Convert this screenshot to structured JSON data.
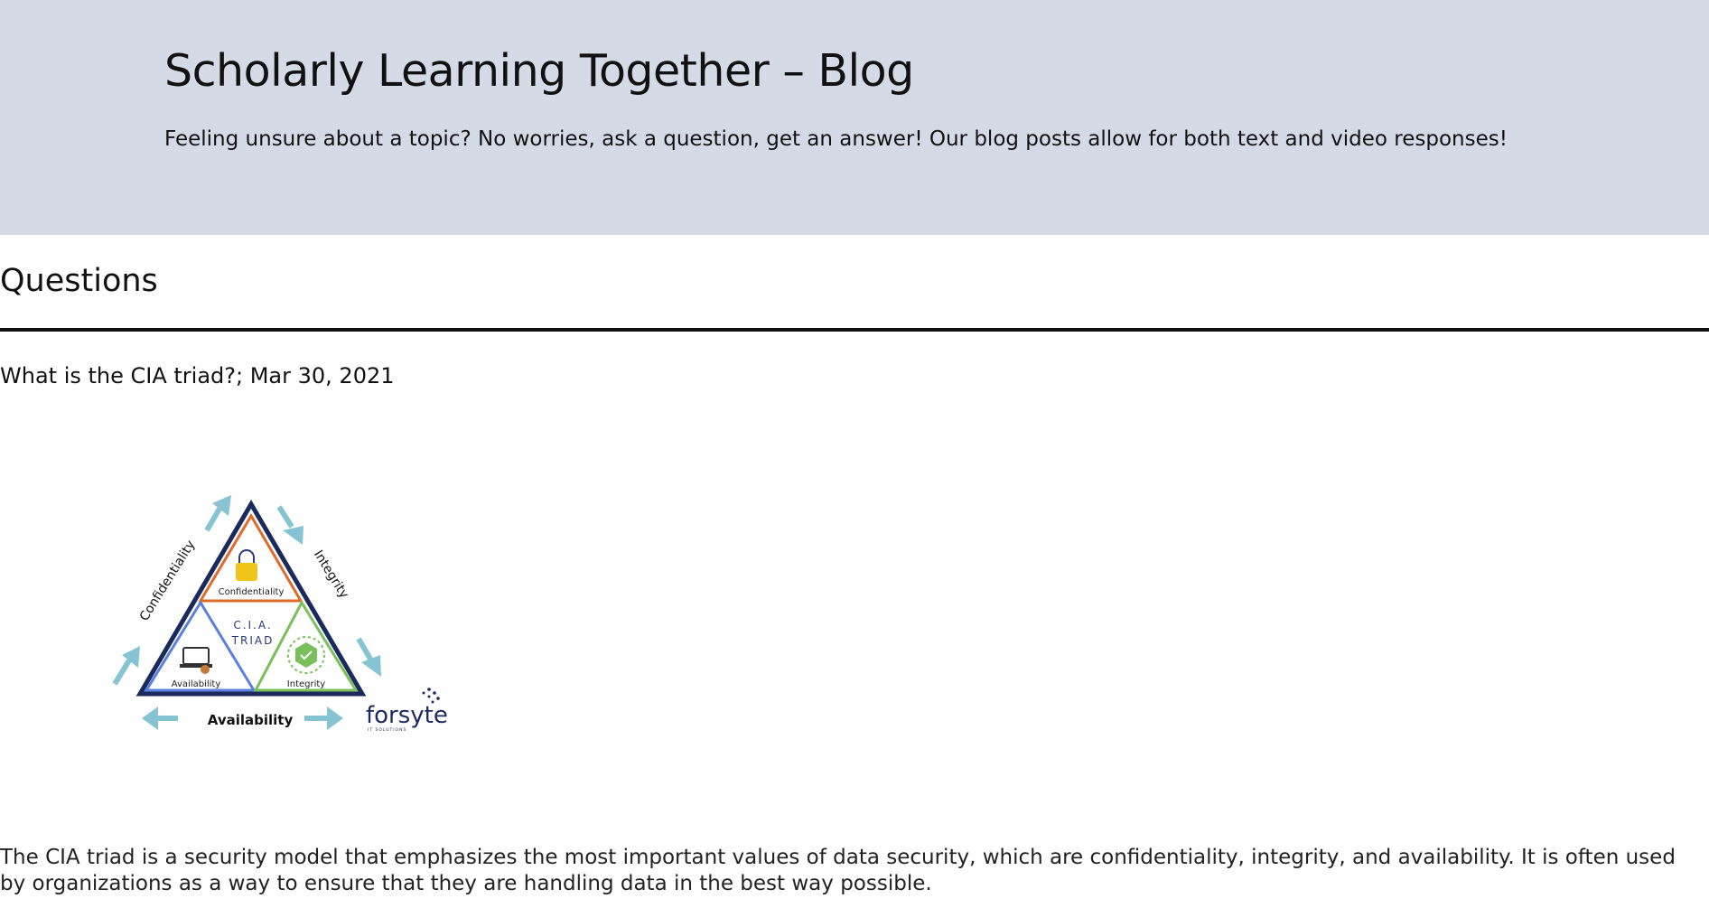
{
  "header": {
    "title": "Scholarly Learning Together – Blog",
    "tagline": "Feeling unsure about a topic? No worries, ask a question, get an answer! Our blog posts allow for both text and video responses!"
  },
  "questions": {
    "section_title": "Questions",
    "posts": [
      {
        "heading": "What is the CIA triad?; Mar 30, 2021",
        "image": {
          "center_line1": "C.I.A.",
          "center_line2": "TRIAD",
          "inner_confidentiality": "Confidentiality",
          "inner_availability": "Availability",
          "inner_integrity": "Integrity",
          "outer_left": "Confidentiality",
          "outer_right": "Integrity",
          "outer_bottom": "Availability",
          "logo": "forsyte",
          "logo_sub": "IT SOLUTIONS"
        },
        "body": "The CIA triad is a security model that emphasizes the most important values of data security, which are confidentiality, integrity, and availability. It is often used by organizations as a way to ensure that they are handling data in the best way possible."
      }
    ]
  },
  "colors": {
    "hero_bg": "#d4dae6",
    "triangle_outline": "#1b2a5c",
    "confidentiality": "#e06a2a",
    "availability": "#5a7fe0",
    "integrity": "#7abf5a",
    "arrow": "#86c4d4",
    "lock": "#f0c419"
  }
}
